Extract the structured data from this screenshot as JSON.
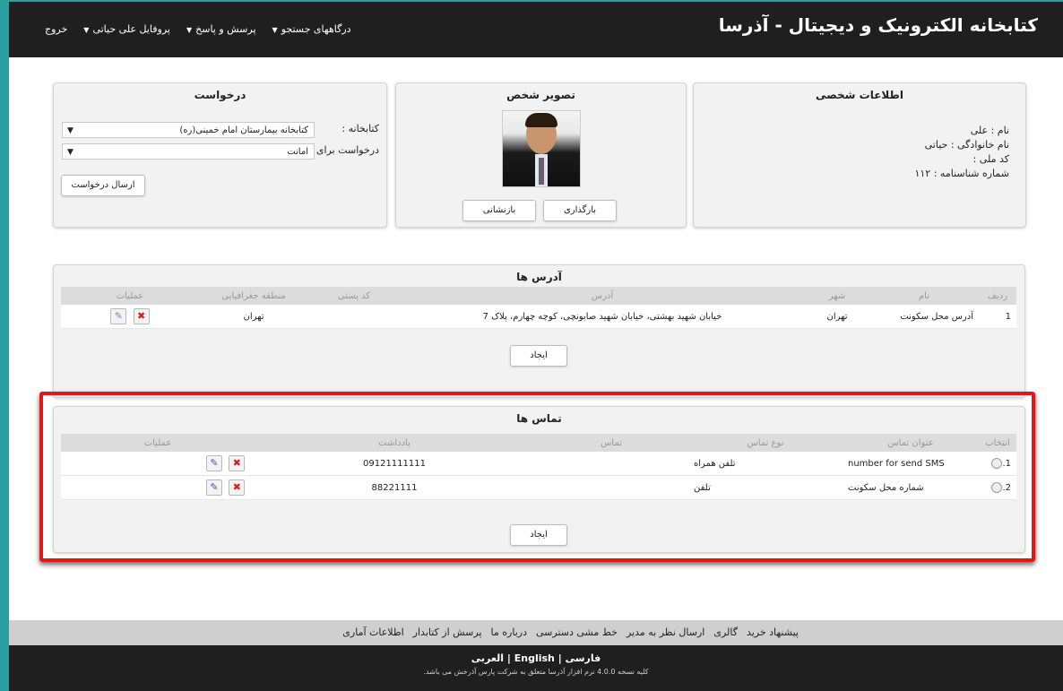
{
  "header": {
    "title": "کتابخانه الکترونیک و دیجیتال - آذرسا",
    "nav": [
      {
        "label": "درگاههای جستجو",
        "dropdown": true
      },
      {
        "label": "پرسش و پاسخ",
        "dropdown": true
      },
      {
        "label": "پروفایل علی حیاتی",
        "dropdown": true
      },
      {
        "label": "خروج",
        "dropdown": false
      }
    ]
  },
  "personal": {
    "title": "اطلاعات شخصی",
    "name_label": "نام :",
    "name_value": "علی",
    "family_label": "نام خانوادگی :",
    "family_value": "حیاتی",
    "national_code_label": "کد ملی :",
    "national_code_value": "",
    "id_number_label": "شماره شناسنامه :",
    "id_number_value": "۱۱۲"
  },
  "photo": {
    "title": "تصویر شخص",
    "upload_label": "بارگذاری",
    "reset_label": "بازنشانی"
  },
  "request": {
    "title": "درخواست",
    "library_label": "کتابخانه :",
    "library_value": "کتابخانه بیمارستان امام خمینی(ره)",
    "request_for_label": "درخواست برای :",
    "request_for_value": "امانت",
    "submit_label": "ارسال درخواست"
  },
  "addresses": {
    "title": "آدرس ها",
    "columns": [
      "ردیف",
      "نام",
      "شهر",
      "آدرس",
      "کد پستی",
      "منطقه جغرافیایی",
      "عملیات"
    ],
    "rows": [
      {
        "index": "1",
        "name": "آدرس محل سکونت",
        "city": "تهران",
        "address": "خیابان شهید بهشتی، خیابان شهید صابونچی، کوچه چهارم، پلاک 7",
        "postal": "",
        "region": "تهران"
      }
    ],
    "create_label": "ایجاد"
  },
  "contacts": {
    "title": "تماس ها",
    "columns": [
      "انتخاب",
      "عنوان تماس",
      "نوع تماس",
      "تماس",
      "یادداشت",
      "عملیات"
    ],
    "rows": [
      {
        "index": "1.",
        "title": "number for send SMS",
        "type": "تلفن همراه",
        "contact": "",
        "note": "09121111111"
      },
      {
        "index": "2.",
        "title": "شماره محل سکونت",
        "type": "تلفن",
        "contact": "",
        "note": "88221111"
      }
    ],
    "create_label": "ایجاد"
  },
  "footer": {
    "links": [
      "پیشنهاد خرید",
      "گالری",
      "ارسال نظر به مدیر",
      "خط مشی دسترسی",
      "درباره ما",
      "پرسش از کتابدار",
      "اطلاعات آماری"
    ],
    "lang_fa": "فارسی",
    "lang_sep1": "|",
    "lang_en": "English",
    "lang_sep2": "|",
    "lang_ar": "العربی",
    "copyright": "کلیه نسخه 4.0.0 نرم افزار آذرسا متعلق به شرکت پارس آذرخش می باشد."
  }
}
